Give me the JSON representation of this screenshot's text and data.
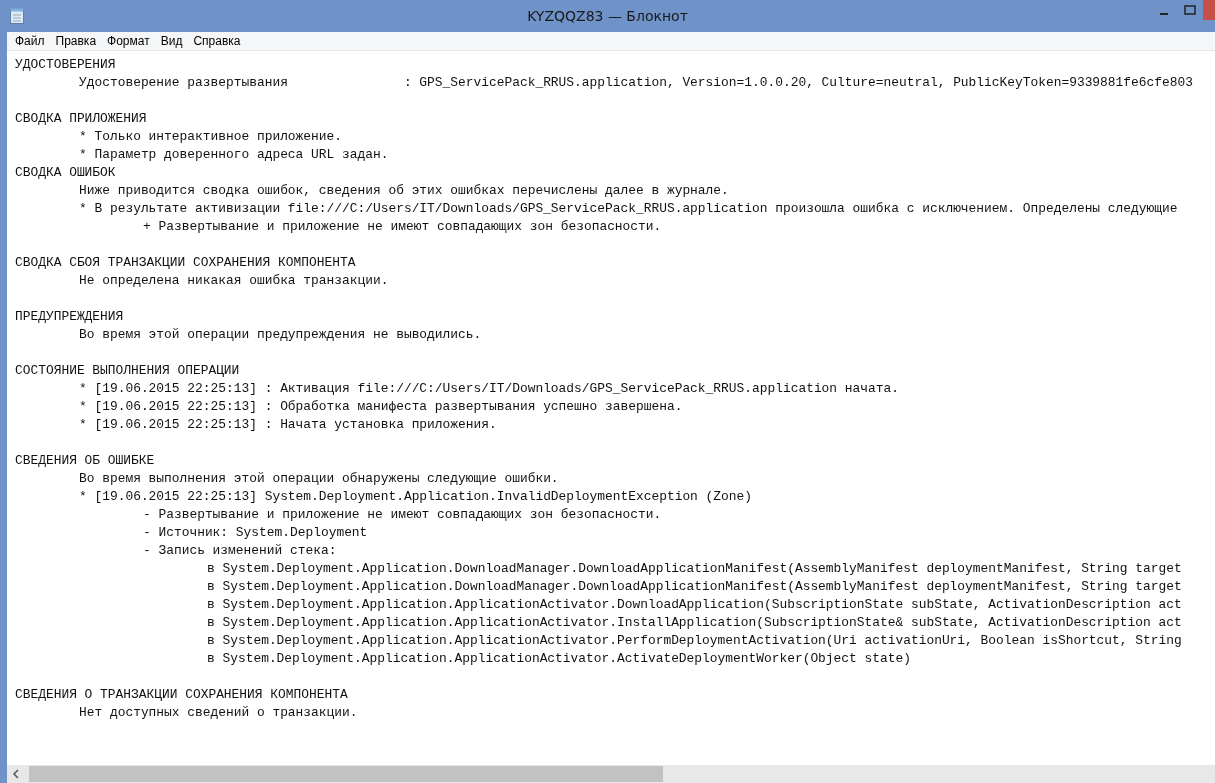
{
  "window": {
    "title": "KYZQQZ83 — Блокнот"
  },
  "menu": [
    "Файл",
    "Правка",
    "Формат",
    "Вид",
    "Справка"
  ],
  "groups": [
    {
      "sections": [
        {
          "heading": "УДОСТОВЕРЕНИЯ",
          "lines": [
            {
              "text": "Удостоверение развертывания               : GPS_ServicePack_RRUS.application, Version=1.0.0.20, Culture=neutral, PublicKeyToken=9339881fe6cfe803"
            }
          ]
        }
      ]
    },
    {
      "sections": [
        {
          "heading": "СВОДКА ПРИЛОЖЕНИЯ",
          "lines": [
            {
              "text": "* Только интерактивное приложение."
            },
            {
              "text": "* Параметр доверенного адреса URL задан."
            }
          ]
        },
        {
          "heading": "СВОДКА ОШИБОК",
          "lines": [
            {
              "text": "Ниже приводится сводка ошибок, сведения об этих ошибках перечислены далее в журнале."
            },
            {
              "text": "* В результате активизации file:///C:/Users/IT/Downloads/GPS_ServicePack_RRUS.application произошла ошибка с исключением. Определены следующие",
              "children": [
                {
                  "text": "+ Развертывание и приложение не имеют совпадающих зон безопасности."
                }
              ]
            }
          ]
        }
      ]
    },
    {
      "sections": [
        {
          "heading": "СВОДКА СБОЯ ТРАНЗАКЦИИ СОХРАНЕНИЯ КОМПОНЕНТА",
          "lines": [
            {
              "text": "Не определена никакая ошибка транзакции."
            }
          ]
        }
      ]
    },
    {
      "sections": [
        {
          "heading": "ПРЕДУПРЕЖДЕНИЯ",
          "lines": [
            {
              "text": "Во время этой операции предупреждения не выводились."
            }
          ]
        }
      ]
    },
    {
      "sections": [
        {
          "heading": "СОСТОЯНИЕ ВЫПОЛНЕНИЯ ОПЕРАЦИИ",
          "lines": [
            {
              "text": "* [19.06.2015 22:25:13] : Активация file:///C:/Users/IT/Downloads/GPS_ServicePack_RRUS.application начата."
            },
            {
              "text": "* [19.06.2015 22:25:13] : Обработка манифеста развертывания успешно завершена."
            },
            {
              "text": "* [19.06.2015 22:25:13] : Начата установка приложения."
            }
          ]
        }
      ]
    },
    {
      "sections": [
        {
          "heading": "СВЕДЕНИЯ ОБ ОШИБКЕ",
          "lines": [
            {
              "text": "Во время выполнения этой операции обнаружены следующие ошибки."
            },
            {
              "text": "* [19.06.2015 22:25:13] System.Deployment.Application.InvalidDeploymentException (Zone)",
              "children": [
                {
                  "text": "- Развертывание и приложение не имеют совпадающих зон безопасности."
                },
                {
                  "text": "- Источник: System.Deployment"
                },
                {
                  "text": "- Запись изменений стека:",
                  "children": [
                    {
                      "text": "в System.Deployment.Application.DownloadManager.DownloadApplicationManifest(AssemblyManifest deploymentManifest, String target"
                    },
                    {
                      "text": "в System.Deployment.Application.DownloadManager.DownloadApplicationManifest(AssemblyManifest deploymentManifest, String target"
                    },
                    {
                      "text": "в System.Deployment.Application.ApplicationActivator.DownloadApplication(SubscriptionState subState, ActivationDescription act"
                    },
                    {
                      "text": "в System.Deployment.Application.ApplicationActivator.InstallApplication(SubscriptionState& subState, ActivationDescription act"
                    },
                    {
                      "text": "в System.Deployment.Application.ApplicationActivator.PerformDeploymentActivation(Uri activationUri, Boolean isShortcut, String"
                    },
                    {
                      "text": "в System.Deployment.Application.ApplicationActivator.ActivateDeploymentWorker(Object state)"
                    }
                  ]
                }
              ]
            }
          ]
        }
      ]
    },
    {
      "sections": [
        {
          "heading": "СВЕДЕНИЯ О ТРАНЗАКЦИИ СОХРАНЕНИЯ КОМПОНЕНТА",
          "lines": [
            {
              "text": "Нет доступных сведений о транзакции."
            }
          ]
        }
      ]
    }
  ]
}
